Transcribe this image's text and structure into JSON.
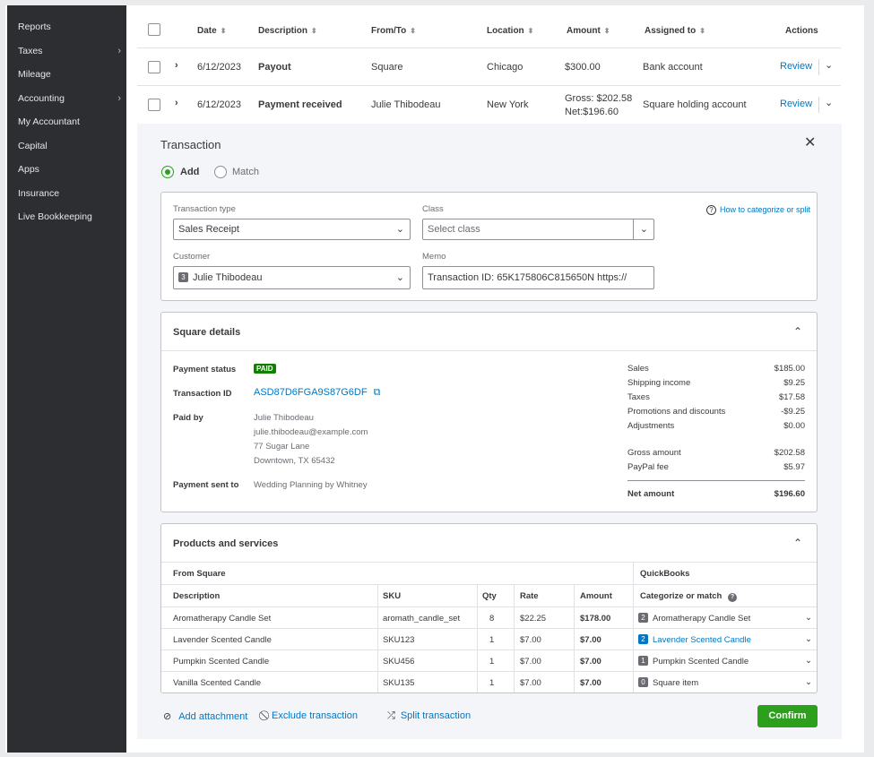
{
  "sidebar": {
    "items": [
      {
        "label": "Reports",
        "has_children": false
      },
      {
        "label": "Taxes",
        "has_children": true
      },
      {
        "label": "Mileage",
        "has_children": false
      },
      {
        "label": "Accounting",
        "has_children": true
      },
      {
        "label": "My Accountant",
        "has_children": false
      },
      {
        "label": "Capital",
        "has_children": false
      },
      {
        "label": "Apps",
        "has_children": false
      },
      {
        "label": "Insurance",
        "has_children": false
      },
      {
        "label": "Live Bookkeeping",
        "has_children": false
      }
    ]
  },
  "table": {
    "headers": {
      "date": "Date",
      "description": "Description",
      "from_to": "From/To",
      "location": "Location",
      "amount": "Amount",
      "assigned_to": "Assigned to",
      "actions": "Actions"
    },
    "rows": [
      {
        "date": "6/12/2023",
        "description": "Payout",
        "from_to": "Square",
        "location": "Chicago",
        "amount": "$300.00",
        "amount2": "",
        "assigned_to": "Bank account",
        "action": "Review"
      },
      {
        "date": "6/12/2023",
        "description": "Payment received",
        "from_to": "Julie Thibodeau",
        "location": "New York",
        "amount": "Gross: $202.58",
        "amount2": "Net:$196.60",
        "assigned_to": "Square holding account",
        "action": "Review"
      }
    ]
  },
  "transaction": {
    "title": "Transaction",
    "mode_add": "Add",
    "mode_match": "Match",
    "selected_mode": "Add",
    "type_label": "Transaction type",
    "type_value": "Sales Receipt",
    "class_label": "Class",
    "class_placeholder": "Select class",
    "help_link": "How to categorize or split",
    "customer_label": "Customer",
    "customer_badge": "3",
    "customer_value": "Julie Thibodeau",
    "memo_label": "Memo",
    "memo_value": "Transaction ID: 65K175806C815650N https://"
  },
  "square_details": {
    "title": "Square details",
    "payment_status_label": "Payment status",
    "payment_status": "PAID",
    "transaction_id_label": "Transaction ID",
    "transaction_id": "ASD87D6FGA9S87G6DF",
    "paid_by_label": "Paid by",
    "paid_by": [
      "Julie Thibodeau",
      "julie.thibodeau@example.com",
      "77 Sugar Lane",
      "Downtown, TX 65432"
    ],
    "sent_to_label": "Payment sent to",
    "sent_to": "Wedding Planning by Whitney",
    "summary": [
      {
        "label": "Sales",
        "value": "$185.00"
      },
      {
        "label": "Shipping income",
        "value": "$9.25"
      },
      {
        "label": "Taxes",
        "value": "$17.58"
      },
      {
        "label": "Promotions and discounts",
        "value": "-$9.25"
      },
      {
        "label": "Adjustments",
        "value": "$0.00"
      },
      {
        "label": "Gross amount",
        "value": "$202.58"
      },
      {
        "label": "PayPal fee",
        "value": "$5.97"
      }
    ],
    "net_label": "Net amount",
    "net_value": "$196.60"
  },
  "products": {
    "title": "Products and services",
    "from_square": "From Square",
    "quickbooks": "QuickBooks",
    "headers": {
      "description": "Description",
      "sku": "SKU",
      "qty": "Qty",
      "rate": "Rate",
      "amount": "Amount",
      "categorize": "Categorize or match"
    },
    "rows": [
      {
        "description": "Aromatherapy Candle Set",
        "sku": "aromath_candle_set",
        "qty": "8",
        "rate": "$22.25",
        "amount": "$178.00",
        "badge": "2",
        "match": "Aromatherapy Candle Set",
        "highlight": false
      },
      {
        "description": "Lavender Scented Candle",
        "sku": "SKU123",
        "qty": "1",
        "rate": "$7.00",
        "amount": "$7.00",
        "badge": "2",
        "match": "Lavender Scented Candle",
        "highlight": true
      },
      {
        "description": "Pumpkin Scented Candle",
        "sku": "SKU456",
        "qty": "1",
        "rate": "$7.00",
        "amount": "$7.00",
        "badge": "1",
        "match": "Pumpkin Scented Candle",
        "highlight": false
      },
      {
        "description": "Vanilla Scented Candle",
        "sku": "SKU135",
        "qty": "1",
        "rate": "$7.00",
        "amount": "$7.00",
        "badge": "0",
        "match": "Square item",
        "highlight": false
      }
    ]
  },
  "footer": {
    "add_attachment": "Add attachment",
    "exclude": "Exclude transaction",
    "split": "Split transaction",
    "confirm": "Confirm"
  },
  "colors": {
    "accent": "#0077c5",
    "confirm": "#2ca01c",
    "paid_badge": "#108000",
    "sidebar": "#2d2e31"
  },
  "icons": {
    "close": "close-icon",
    "chevron": "chevron-down-icon",
    "help": "help-circle-icon",
    "external": "external-link-icon",
    "paperclip": "paperclip-icon",
    "exclude": "block-icon",
    "split": "split-icon"
  }
}
